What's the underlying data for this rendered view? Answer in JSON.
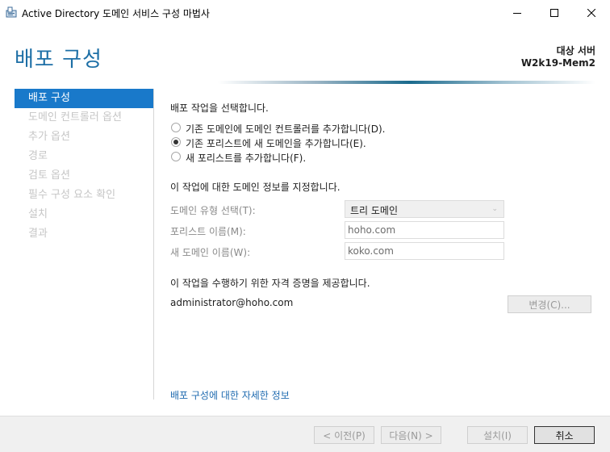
{
  "window": {
    "title": "Active Directory 도메인 서비스 구성 마법사",
    "icons": {
      "app": "ad-wizard-icon",
      "minimize": "minimize-icon",
      "maximize": "maximize-icon",
      "close": "close-icon"
    }
  },
  "header": {
    "page_title": "배포 구성",
    "target_label": "대상 서버",
    "target_server": "W2k19-Mem2"
  },
  "sidebar": {
    "items": [
      {
        "label": "배포 구성",
        "active": true
      },
      {
        "label": "도메인 컨트롤러 옵션",
        "active": false
      },
      {
        "label": "추가 옵션",
        "active": false
      },
      {
        "label": "경로",
        "active": false
      },
      {
        "label": "검토 옵션",
        "active": false
      },
      {
        "label": "필수 구성 요소 확인",
        "active": false
      },
      {
        "label": "설치",
        "active": false
      },
      {
        "label": "결과",
        "active": false
      }
    ]
  },
  "main": {
    "select_operation_heading": "배포 작업을 선택합니다.",
    "operations": [
      {
        "label": "기존 도메인에 도메인 컨트롤러를 추가합니다(D).",
        "checked": false
      },
      {
        "label": "기존 포리스트에 새 도메인을 추가합니다(E).",
        "checked": true
      },
      {
        "label": "새 포리스트를 추가합니다(F).",
        "checked": false
      }
    ],
    "domain_info_heading": "이 작업에 대한 도메인 정보를 지정합니다.",
    "domain_type_label": "도메인 유형 선택(T):",
    "domain_type_value": "트리 도메인",
    "forest_name_label": "포리스트 이름(M):",
    "forest_name_value": "hoho.com",
    "new_domain_label": "새 도메인 이름(W):",
    "new_domain_value": "koko.com",
    "credentials_heading": "이 작업을 수행하기 위한 자격 증명을 제공합니다.",
    "credentials_user": "administrator@hoho.com",
    "change_button": "변경(C)...",
    "more_info_link": "배포 구성에 대한 자세한 정보"
  },
  "footer": {
    "prev_button": "< 이전(P)",
    "next_button": "다음(N) >",
    "install_button": "설치(I)",
    "cancel_button": "취소"
  }
}
